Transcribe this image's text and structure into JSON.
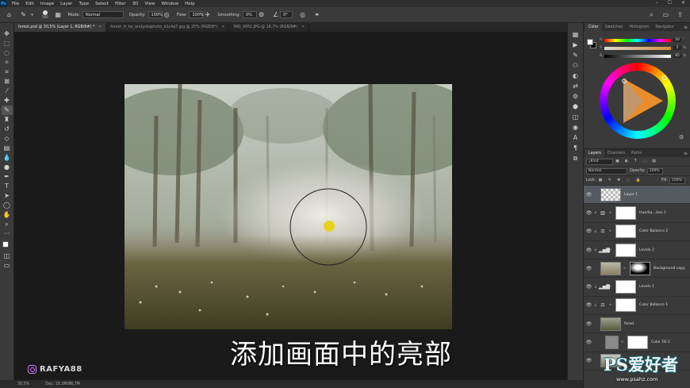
{
  "menu": {
    "logo": "Ps",
    "items": [
      "File",
      "Edit",
      "Image",
      "Layer",
      "Type",
      "Select",
      "Filter",
      "3D",
      "View",
      "Window",
      "Help"
    ],
    "window_controls": [
      "–",
      "☐",
      "✕"
    ]
  },
  "options": {
    "brush_size": "500",
    "mode_label": "Mode:",
    "mode_value": "Normal",
    "opacity_label": "Opacity:",
    "opacity_value": "100%",
    "flow_label": "Flow:",
    "flow_value": "100%",
    "smoothing_label": "Smoothing:",
    "smoothing_value": "0%",
    "angle_value": "0°"
  },
  "tabs": [
    {
      "label": "forest.psd @ 30,5% (Layer 1, RGB/8#) *",
      "active": true
    },
    {
      "label": "forest_iii_by_andyskaphoto_d1c4a7.jpg @ 25% (RGB/8*)",
      "active": false
    },
    {
      "label": "IMG_9951.JPG @ 16,7% (RGB/8#)",
      "active": false
    }
  ],
  "status": {
    "zoom": "30,5%",
    "doc": "Doc: 15,3M/86,7M"
  },
  "subtitle": "添加画面中的亮部",
  "watermark": "RAFYA88",
  "color_panel": {
    "tabs": [
      "Color",
      "Swatches",
      "Histogram",
      "Navigator"
    ],
    "sliders": [
      {
        "tag": "H",
        "value": "30",
        "unit": "°"
      },
      {
        "tag": "S",
        "value": "5",
        "unit": "%"
      },
      {
        "tag": "B",
        "value": "85",
        "unit": "%"
      }
    ]
  },
  "layers_panel": {
    "tabs": [
      "Layers",
      "Channels",
      "Paths"
    ],
    "filter_kind": "Kind",
    "blend_mode": "Normal",
    "opacity_label": "Opacity:",
    "opacity_value": "100%",
    "lock_label": "Lock:",
    "fill_label": "Fill:",
    "fill_value": "100%",
    "layers": [
      {
        "name": "Layer 1",
        "type": "pixel",
        "selected": true
      },
      {
        "name": "Hue/Sa...tion 1",
        "type": "hue",
        "clip": true
      },
      {
        "name": "Color Balance 2",
        "type": "balance",
        "clip": true
      },
      {
        "name": "Levels 2",
        "type": "levels",
        "clip": true
      },
      {
        "name": "Background copy",
        "type": "photo-mask"
      },
      {
        "name": "Levels 1",
        "type": "levels",
        "clip": true
      },
      {
        "name": "Color Balance 1",
        "type": "balance",
        "clip": true
      },
      {
        "name": "fored.",
        "type": "photo"
      },
      {
        "name": "Color Fill 1",
        "type": "fill"
      },
      {
        "name": "",
        "type": "photo"
      }
    ]
  },
  "site_logo": {
    "text": "PS爱好者",
    "url_text": "www.psahz.com"
  },
  "colors": {
    "accent_blue": "#31a8ff",
    "cursor_dot": "#e8d21e"
  }
}
